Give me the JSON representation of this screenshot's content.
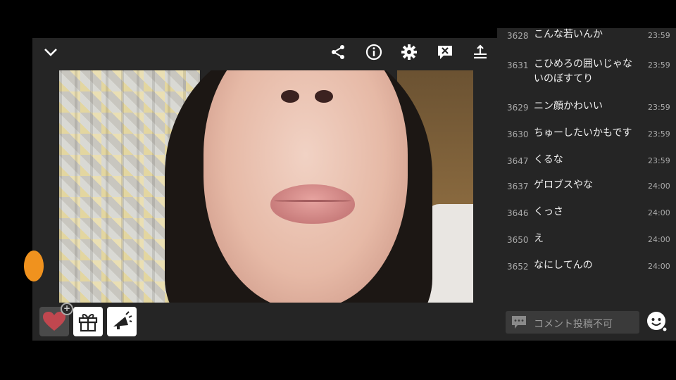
{
  "header": {
    "icons": [
      "chevron-down-icon",
      "share-icon",
      "info-icon",
      "gear-icon",
      "comment-off-icon",
      "download-icon"
    ]
  },
  "comments": [
    {
      "no": "3628",
      "text": "こんな若いんか",
      "time": "23:59"
    },
    {
      "no": "3631",
      "text": "こひめろの囲いじゃないのぼすてり",
      "time": "23:59"
    },
    {
      "no": "3629",
      "text": "ニン顔かわいい",
      "time": "23:59"
    },
    {
      "no": "3630",
      "text": "ちゅーしたいかもです",
      "time": "23:59"
    },
    {
      "no": "3647",
      "text": "くるな",
      "time": "23:59"
    },
    {
      "no": "3637",
      "text": "ゲロブスやな",
      "time": "24:00"
    },
    {
      "no": "3646",
      "text": "くっさ",
      "time": "24:00"
    },
    {
      "no": "3650",
      "text": "え",
      "time": "24:00"
    },
    {
      "no": "3652",
      "text": "なにしてんの",
      "time": "24:00"
    }
  ],
  "comment_input": {
    "placeholder": "コメント投稿不可"
  },
  "colors": {
    "panel": "#252525",
    "accent_orange": "#f0921e",
    "heart": "#c0474f"
  }
}
